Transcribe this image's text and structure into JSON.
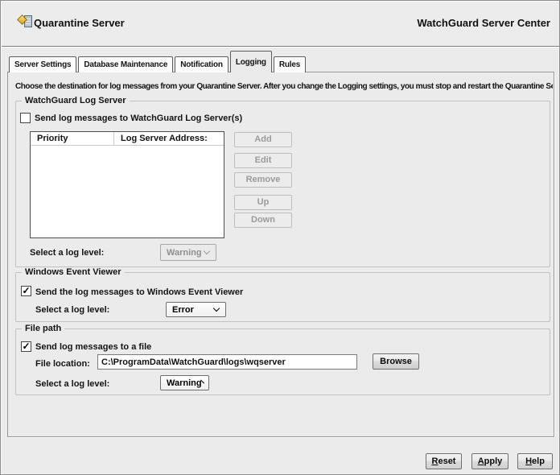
{
  "header": {
    "title": "Quarantine Server",
    "product_title": "WatchGuard Server Center"
  },
  "tabs": [
    {
      "label": "Server Settings",
      "active": false
    },
    {
      "label": "Database Maintenance",
      "active": false
    },
    {
      "label": "Notification",
      "active": false
    },
    {
      "label": "Logging",
      "active": true
    },
    {
      "label": "Rules",
      "active": false
    }
  ],
  "description": "Choose the destination for log messages from your Quarantine Server. After you change the Logging settings, you must stop and restart the Quarantine Server.",
  "watchguard_log_server": {
    "group_label": "WatchGuard Log Server",
    "checkbox_label": "Send log messages to WatchGuard Log Server(s)",
    "checked": false,
    "table": {
      "columns": [
        "Priority",
        "Log Server Address:"
      ],
      "rows": []
    },
    "buttons": [
      "Add",
      "Edit",
      "Remove",
      "Up",
      "Down"
    ],
    "buttons_enabled": false,
    "log_level_label": "Select a log level:",
    "log_level_value": "Warning",
    "log_level_enabled": false
  },
  "windows_event_viewer": {
    "group_label": "Windows Event Viewer",
    "checkbox_label": "Send the log messages to Windows Event Viewer",
    "checked": true,
    "log_level_label": "Select a log level:",
    "log_level_value": "Error",
    "log_level_enabled": true
  },
  "file_path": {
    "group_label": "File path",
    "checkbox_label": "Send log messages to a file",
    "checked": true,
    "file_location_label": "File location:",
    "file_location_value": "C:\\ProgramData\\WatchGuard\\logs\\wqserver",
    "browse_label": "Browse",
    "log_level_label": "Select a log level:",
    "log_level_value": "Warning",
    "log_level_enabled": true
  },
  "footer": {
    "reset_label": "Reset",
    "apply_label": "Apply",
    "help_label": "Help"
  },
  "icons": {
    "app": "quarantine-server-icon",
    "check": "✓",
    "chevron": "chevron-down"
  },
  "colors": {
    "window_bg": "#ebebeb",
    "header_bg": "#ececec",
    "panel_border": "#989898",
    "groupbox_border": "#c2c2c2",
    "disabled_text": "#9b9b9b",
    "accent_diamond": "#e0a317"
  }
}
